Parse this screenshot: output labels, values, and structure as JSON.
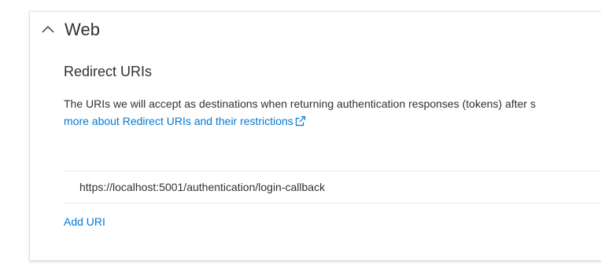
{
  "section": {
    "title": "Web",
    "expanded": true,
    "chevron_icon": "chevron-up-icon"
  },
  "redirect": {
    "heading": "Redirect URIs",
    "description": "The URIs we will accept as destinations when returning authentication responses (tokens) after s",
    "learn_more": "more about Redirect URIs and their restrictions",
    "external_icon": "external-link-icon",
    "uris": [
      "https://localhost:5001/authentication/login-callback"
    ],
    "add_label": "Add URI"
  },
  "colors": {
    "link": "#0078d4",
    "text": "#323130",
    "border": "#edebe9"
  }
}
